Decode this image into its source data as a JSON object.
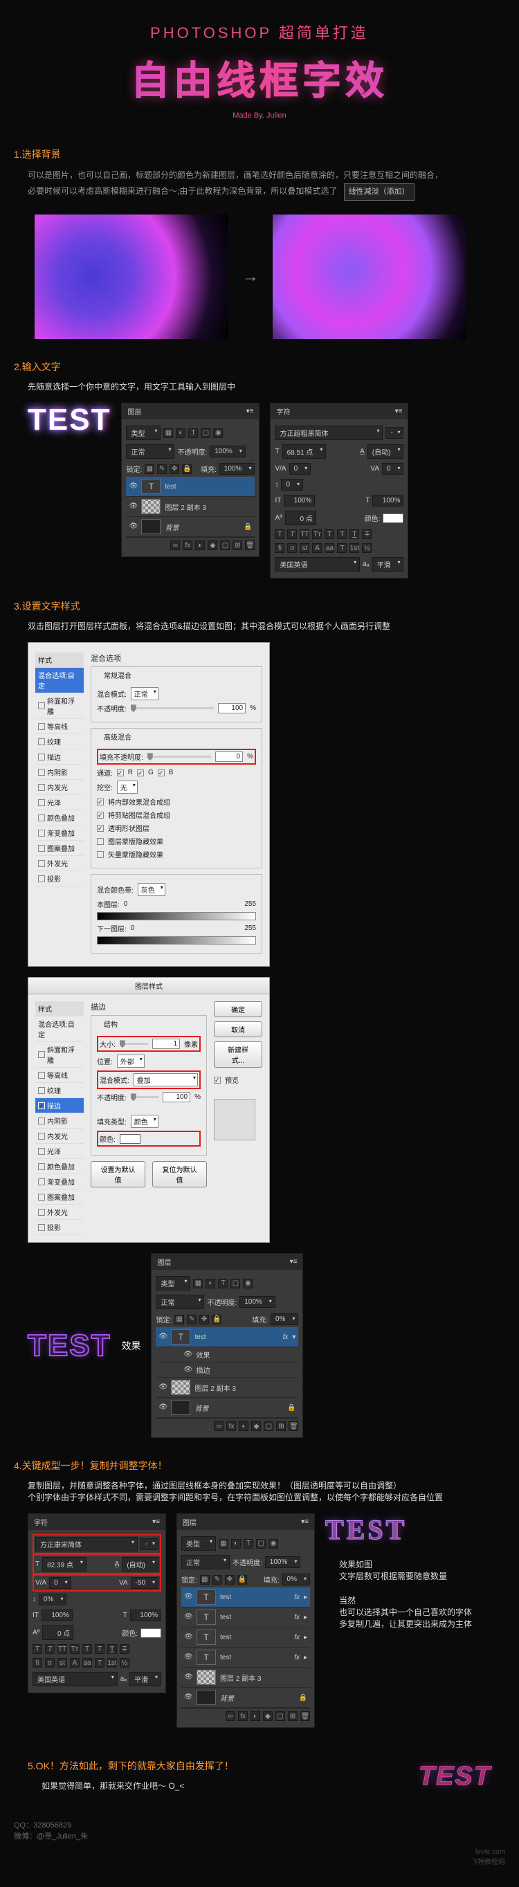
{
  "hero": {
    "super": "PHOTOSHOP   超简单打造",
    "title": "自由线框字效",
    "credit": "Made By. Julien"
  },
  "s1": {
    "title": "1.选择背景",
    "line1": "可以是图片，也可以自己画，标题部分的颜色为新建图层，画笔选好颜色后随意涂的，只要注意互相之间的融合，",
    "line2": "必要时候可以考虑高斯模糊来进行融合～;由于此教程为深色背景，所以叠加模式选了",
    "mode": "线性减淡（添加）",
    "arrow": "→"
  },
  "s2": {
    "title": "2.输入文字",
    "text": "先随意选择一个你中意的文字，用文字工具输入到图层中",
    "sample": "TEST",
    "layers_panel": {
      "tab": "图层",
      "typefilter": "类型",
      "mode": "正常",
      "opacity_lbl": "不透明度:",
      "opacity": "100%",
      "lock_lbl": "锁定:",
      "fill_lbl": "填充:",
      "fill": "100%",
      "layer1": "test",
      "layer2": "图层 2 副本 3",
      "layer3": "背景"
    },
    "char_panel": {
      "tab": "字符",
      "font": "方正超粗黑简体",
      "size_lbl": "T",
      "size": "68.51 点",
      "leading_lbl": "A",
      "leading": "(自动)",
      "track": "0",
      "kern": "0",
      "v100": "100%",
      "h100": "100%",
      "baseline": "0 点",
      "color_lbl": "颜色:",
      "lang": "美国英语",
      "aa": "平滑"
    }
  },
  "s3": {
    "title": "3.设置文字样式",
    "text": "双击图层打开图层样式面板，将混合选项&描边设置如图；其中混合模式可以根据个人画面另行调整",
    "dlg_title": "图层样式",
    "left_list": {
      "hdr": "样式",
      "sel": "混合选项:自定",
      "i1": "斜面和浮雕",
      "i2": "等高线",
      "i3": "纹理",
      "i4": "描边",
      "i5": "内阴影",
      "i6": "内发光",
      "i7": "光泽",
      "i8": "颜色叠加",
      "i9": "渐变叠加",
      "i10": "图案叠加",
      "i11": "外发光",
      "i12": "投影"
    },
    "blend": {
      "group1": "混合选项",
      "sub1": "常规混合",
      "mode_lbl": "混合模式:",
      "mode": "正常",
      "op_lbl": "不透明度:",
      "op": "100",
      "pct": "%",
      "sub2": "高级混合",
      "fill_lbl": "填充不透明度:",
      "fill": "0",
      "ch_lbl": "通道:",
      "ch_r": "R",
      "ch_g": "G",
      "ch_b": "B",
      "knock_lbl": "挖空:",
      "knock": "无",
      "c1": "将内部效果混合成组",
      "c2": "将剪贴图层混合成组",
      "c3": "透明形状图层",
      "c4": "图层蒙版隐藏效果",
      "c5": "矢量蒙版隐藏效果",
      "sub3": "混合颜色带:",
      "band": "灰色",
      "this_lbl": "本图层:",
      "v0": "0",
      "v255": "255",
      "under_lbl": "下一图层:"
    },
    "stroke": {
      "group": "描边",
      "sub": "结构",
      "size_lbl": "大小:",
      "size": "1",
      "size_unit": "像素",
      "pos_lbl": "位置:",
      "pos": "外部",
      "mode_lbl": "混合模式:",
      "mode": "叠加",
      "op_lbl": "不透明度:",
      "op": "100",
      "pct": "%",
      "filltype_lbl": "填充类型:",
      "filltype": "颜色",
      "color_lbl": "颜色:",
      "btn1": "设置为默认值",
      "btn2": "复位为默认值",
      "ok": "确定",
      "cancel": "取消",
      "new": "新建样式...",
      "preview": "预览"
    },
    "result_label": "效果",
    "result_panel": {
      "tab": "图层",
      "typefilter": "类型",
      "mode": "正常",
      "opacity_lbl": "不透明度:",
      "opacity": "100%",
      "lock_lbl": "锁定:",
      "fill_lbl": "填充:",
      "fill": "0%",
      "l1": "test",
      "fx": "fx",
      "l1a": "效果",
      "l1b": "描边",
      "l2": "图层 2 副本 3",
      "l3": "背景"
    }
  },
  "s4": {
    "title": "4.关键成型一步！复制并调整字体！",
    "text1": "复制图层，并随意调整各种字体，通过图层线框本身的叠加实现效果！（图层透明度等可以自由调整）",
    "text2": "个别字体由于字体样式不同，需要调整字间距和字号，在字符面板如图位置调整，以使每个字都能够对应各自位置",
    "char": {
      "tab": "字符",
      "font": "方正康宋简体",
      "size": "82.39 点",
      "leading": "(自动)",
      "track": "-50",
      "v0": "0",
      "kern": "0%",
      "v100": "100%",
      "h100": "100%",
      "baseline": "0 点",
      "color_lbl": "颜色:",
      "lang": "美国英语",
      "aa": "平滑"
    },
    "layers": {
      "tab": "图层",
      "typefilter": "类型",
      "mode": "正常",
      "opacity_lbl": "不透明度:",
      "opacity": "100%",
      "lock_lbl": "锁定:",
      "fill_lbl": "填充:",
      "fill": "0%",
      "l1": "test",
      "l2": "test",
      "l3": "test",
      "l4": "test",
      "l5": "图层 2 副本 3",
      "l6": "背景",
      "fx": "fx"
    },
    "note1": "效果如图",
    "note2": "文字层数可根据需要随意数量",
    "note3": "当然",
    "note4": "也可以选择其中一个自己喜欢的字体",
    "note5": "多复制几遍，让其更突出来成为主体"
  },
  "s5": {
    "title": "5.OK！方法如此，剩下的就靠大家自由发挥了！",
    "text": "如果觉得简单，那就来交作业吧～   O_<"
  },
  "footer": {
    "qq_lbl": "QQ：",
    "qq": "328056829",
    "weibo_lbl": "微博：",
    "weibo": "@圣_Julien_朱",
    "wm1": "fevte.com",
    "wm2": "飞特教程网"
  }
}
